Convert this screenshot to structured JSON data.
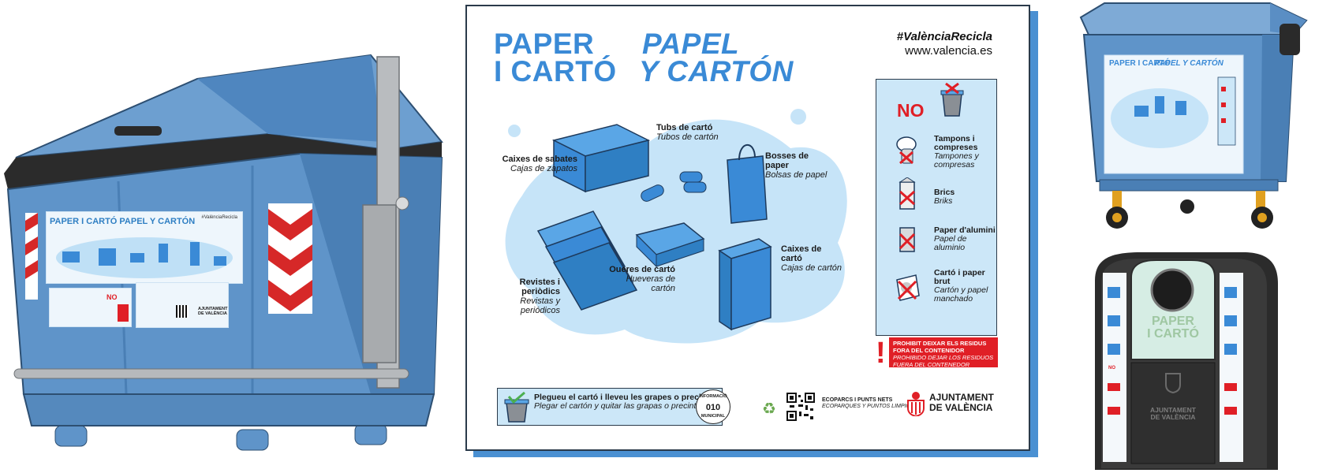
{
  "poster": {
    "title_ca_line1": "PAPER",
    "title_ca_line2": "I CARTÓ",
    "title_es_line1": "PAPEL",
    "title_es_line2": "Y CARTÓN",
    "hashtag": "#ValènciaRecicla",
    "website": "www.valencia.es",
    "items": [
      {
        "ca": "Caixes de sabates",
        "es": "Cajas de zapatos"
      },
      {
        "ca": "Tubs de cartó",
        "es": "Tubos de cartón"
      },
      {
        "ca": "Bosses de paper",
        "es": "Bolsas de papel"
      },
      {
        "ca": "Revistes i periòdics",
        "es": "Revistas y periódicos"
      },
      {
        "ca": "Oueres de cartó",
        "es": "Hueveras de cartón"
      },
      {
        "ca": "Caixes de cartó",
        "es": "Cajas de cartón"
      }
    ],
    "no_panel": {
      "heading": "NO",
      "items": [
        {
          "ca": "Tampons i compreses",
          "es": "Tampones y compresas"
        },
        {
          "ca": "Brics",
          "es": "Briks"
        },
        {
          "ca": "Paper d'alumini",
          "es": "Papel de aluminio"
        },
        {
          "ca": "Cartó i paper brut",
          "es": "Cartón y papel manchado"
        }
      ]
    },
    "warning": {
      "mark": "!",
      "ca": "PROHIBIT DEIXAR ELS RESIDUS FORA DEL CONTENIDOR",
      "es": "PROHIBIDO DEJAR LOS RESIDUOS FUERA DEL CONTENEDOR"
    },
    "fold_tip": {
      "ca": "Plegueu el cartó i lleveu les grapes o precintes",
      "es": "Plegar el cartón y quitar las grapas o precintos"
    },
    "info_badge": {
      "top": "INFORMACIÓ",
      "number": "010",
      "bottom": "MUNICIPAL"
    },
    "ecoparcs": {
      "ca": "ECOPARCS I PUNTS NETS",
      "es": "ECOPARQUES Y PUNTOS LIMPIOS"
    },
    "city_council": {
      "line1": "AJUNTAMENT",
      "line2": "DE VALÈNCIA"
    }
  },
  "left_container_label": {
    "title": "PAPER I CARTÓ   PAPEL Y CARTÓN",
    "hashtag": "#ValènciaRecicla",
    "council": "AJUNTAMENT DE VALÈNCIA",
    "no": "NO"
  },
  "wheelie_bin_label": {
    "title_ca": "PAPER I CARTÓ",
    "title_es": "PAPEL Y CARTÓN"
  },
  "igloo": {
    "label_line1": "PAPER",
    "label_line2": "I CARTÓ",
    "council_line1": "AJUNTAMENT",
    "council_line2": "DE VALÈNCIA",
    "no": "NO"
  },
  "colors": {
    "container_blue": "#5f94c9",
    "poster_blue": "#3a8ad6",
    "light_blue": "#cce7f8",
    "red": "#e01f26",
    "dark": "#2a3a4a"
  }
}
